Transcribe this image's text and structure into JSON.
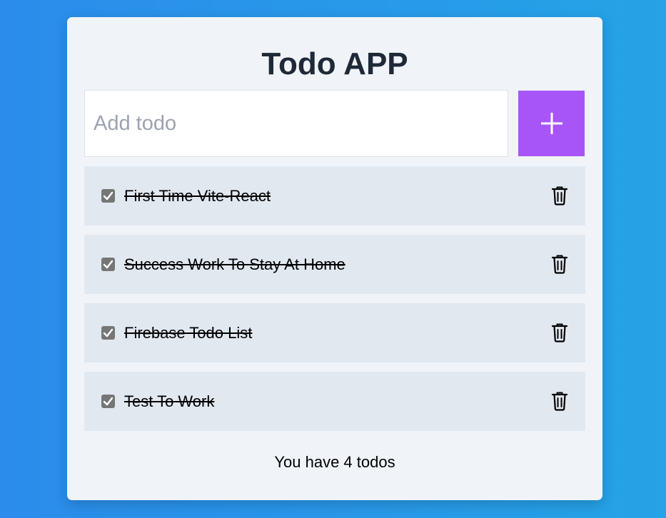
{
  "app": {
    "title": "Todo APP"
  },
  "add": {
    "placeholder": "Add todo",
    "value": "",
    "button_icon": "plus-icon"
  },
  "todos": [
    {
      "text": "First Time Vite-React",
      "completed": true
    },
    {
      "text": "Success Work To Stay At Home",
      "completed": true
    },
    {
      "text": "Firebase Todo List",
      "completed": true
    },
    {
      "text": "Test To Work",
      "completed": true
    }
  ],
  "footer": {
    "count_text": "You have 4 todos"
  },
  "colors": {
    "accent": "#a855f7",
    "card_bg": "#f0f4f8",
    "item_bg": "#e2e8f0",
    "title": "#1f2937",
    "background_start": "#2b8ceb",
    "background_end": "#25a3e6"
  }
}
